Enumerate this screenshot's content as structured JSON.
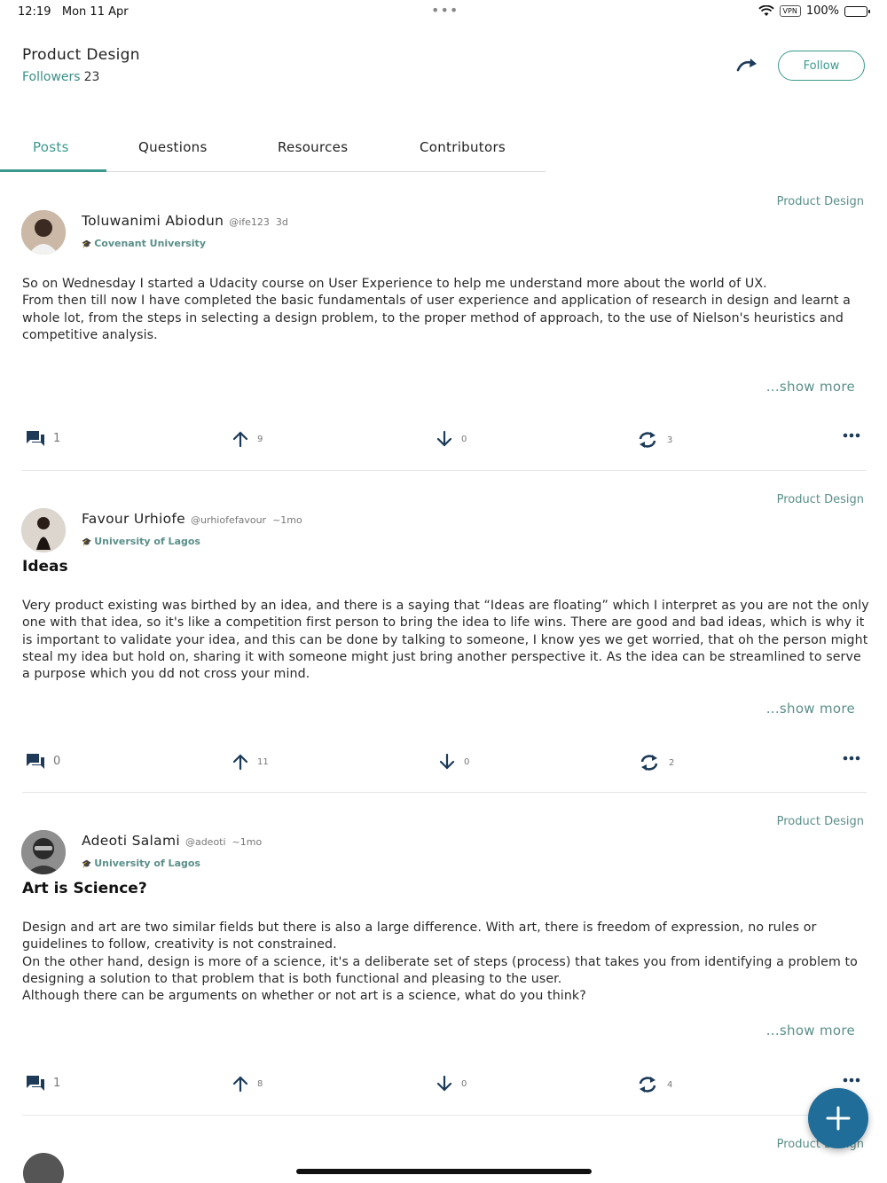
{
  "status_bar": {
    "time": "12:19",
    "date": "Mon 11 Apr",
    "vpn": "VPN",
    "battery": "100%"
  },
  "header": {
    "title": "Product Design",
    "followers_label": "Followers",
    "followers_count": "23",
    "follow_label": "Follow"
  },
  "tabs": [
    {
      "label": "Posts",
      "active": true
    },
    {
      "label": "Questions",
      "active": false
    },
    {
      "label": "Resources",
      "active": false
    },
    {
      "label": "Contributors",
      "active": false
    }
  ],
  "posts": [
    {
      "category": "Product Design",
      "author": "Toluwanimi Abiodun",
      "handle": "@ife123",
      "time": "3d",
      "university": "Covenant University",
      "heading": "",
      "body": "So on Wednesday I started a Udacity course on User Experience to help me understand more about the world of UX.\nFrom then till now I have completed the basic fundamentals of user experience and application of research in design and learnt a whole lot, from the steps in selecting a design problem, to the proper method of approach, to the use of Nielson's heuristics and competitive analysis.",
      "show_more": "...show more",
      "comments": "1",
      "upvotes": "9",
      "downvotes": "0",
      "reposts": "3"
    },
    {
      "category": "Product Design",
      "author": "Favour Urhiofe",
      "handle": "@urhiofefavour",
      "time": "~1mo",
      "university": "University of Lagos",
      "heading": "Ideas",
      "body": " Very product existing was birthed by an idea, and there is a saying that “Ideas are floating” which I interpret as you are not the only one with that idea, so it's like a competition first person to bring the idea to life wins. There are good and bad ideas, which is why it is important to validate your idea, and this can be done by talking to someone, I know yes we get worried, that oh the person might steal my idea but hold on, sharing it with someone might just bring another perspective it. As the idea can be streamlined to serve a purpose which you dd not cross your mind.",
      "show_more": "...show more",
      "comments": "0",
      "upvotes": "11",
      "downvotes": "0",
      "reposts": "2"
    },
    {
      "category": "Product Design",
      "author": "Adeoti Salami",
      "handle": "@adeoti",
      "time": "~1mo",
      "university": "University of Lagos",
      "heading": "Art is Science?",
      "body": "Design and art are two similar fields but there is also a large difference. With art, there is freedom of expression, no rules or guidelines to follow, creativity is not constrained.\nOn the other hand, design is more of a science, it's a deliberate set of steps (process) that takes you from identifying a problem to designing a solution to that problem that is both functional and pleasing to the user.\nAlthough there can be arguments on whether or not art is a science, what do you think?",
      "show_more": "...show more",
      "comments": "1",
      "upvotes": "8",
      "downvotes": "0",
      "reposts": "4"
    }
  ],
  "partial_post": {
    "category": "Product Design"
  },
  "colors": {
    "accent": "#3a9a8d",
    "fab": "#1f6d98",
    "icon_dark": "#1d3b58"
  },
  "icons": [
    "share-icon",
    "comment-icon",
    "upvote-icon",
    "downvote-icon",
    "repost-icon",
    "more-icon",
    "add-icon"
  ]
}
